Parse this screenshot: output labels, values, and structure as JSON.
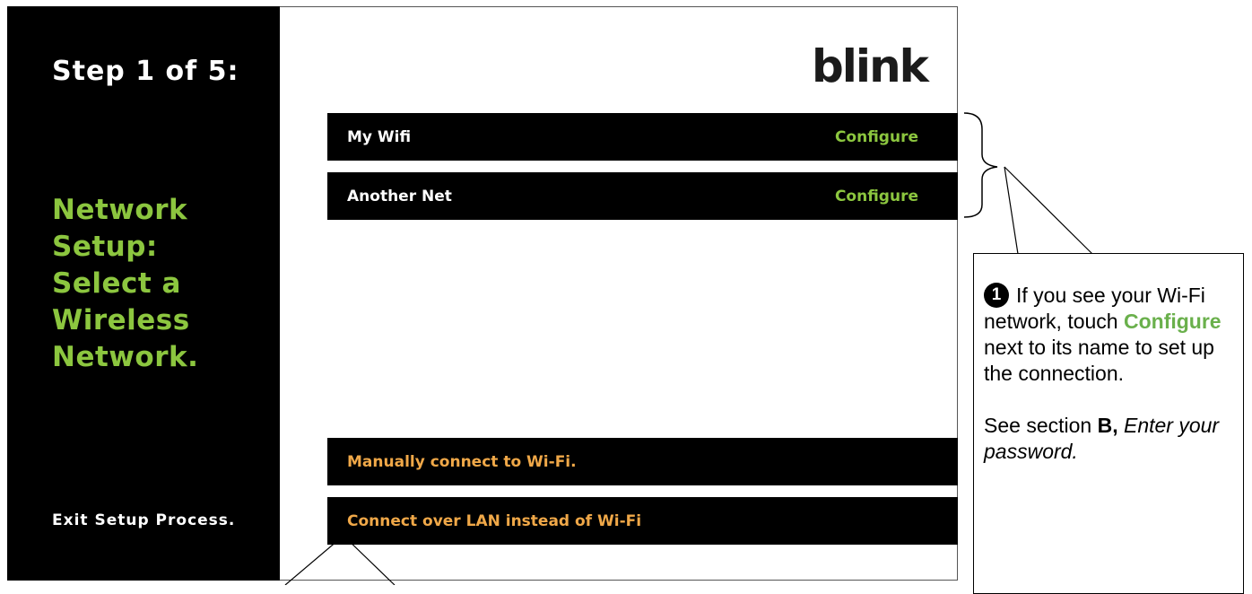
{
  "sidebar": {
    "step": "Step 1 of 5:",
    "title_lines": [
      "Network",
      "Setup:",
      "Select a",
      "Wireless",
      "Network."
    ],
    "exit": "Exit Setup Process."
  },
  "logo": "blink",
  "networks": [
    {
      "name": "My Wifi",
      "action": "Configure"
    },
    {
      "name": "Another Net",
      "action": "Configure"
    }
  ],
  "options": {
    "manual": "Manually connect to Wi-Fi.",
    "lan": "Connect over LAN instead of Wi-Fi"
  },
  "callout": {
    "number": "1",
    "p1_a": "If you see your Wi-Fi network, touch",
    "keyword": "Configure",
    "p1_b": "next to its name to set up the connection.",
    "p2_a": "See section",
    "section": "B,",
    "p2_italic": "Enter your password."
  },
  "colors": {
    "accent_green": "#8cc63f",
    "option_orange": "#f0a848",
    "row_bg": "#000000"
  }
}
